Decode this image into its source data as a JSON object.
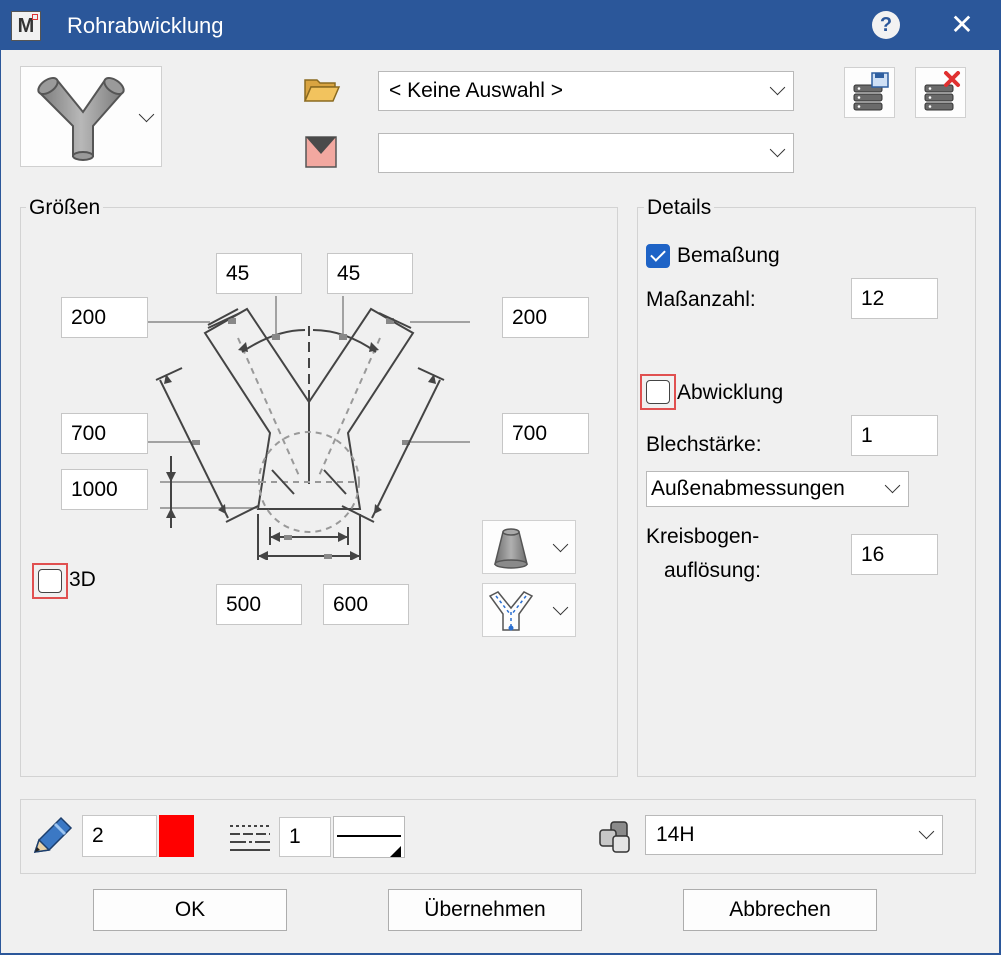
{
  "window": {
    "title": "Rohrabwicklung",
    "app_icon_letter": "M"
  },
  "presets": {
    "selection": "< Keine Auswahl >",
    "second_combo": ""
  },
  "groups": {
    "sizes": "Größen",
    "details": "Details"
  },
  "sizes": {
    "angle_left": "45",
    "angle_right": "45",
    "length_top_left": "200",
    "length_top_right": "200",
    "length_mid_left": "700",
    "length_mid_right": "700",
    "height_left": "1000",
    "diameter_bottom_left": "500",
    "diameter_bottom_right": "600",
    "checkbox_3d_label": "3D",
    "checkbox_3d_checked": false
  },
  "details": {
    "bemassung_label": "Bemaßung",
    "bemassung_checked": true,
    "masszahl_label": "Maßanzahl:",
    "masszahl_value": "12",
    "abwicklung_label": "Abwicklung",
    "abwicklung_checked": false,
    "blechstaerke_label": "Blechstärke:",
    "blechstaerke_value": "1",
    "dimension_mode": "Außenabmessungen",
    "kreisbogen_label_1": "Kreisbogen-",
    "kreisbogen_label_2": "auflösung:",
    "kreisbogen_value": "16"
  },
  "format_bar": {
    "pen_value": "2",
    "pen_color": "#ff0000",
    "line_value": "1",
    "layer_value": "14H"
  },
  "buttons": {
    "ok": "OK",
    "apply": "Übernehmen",
    "cancel": "Abbrechen"
  },
  "colors": {
    "title_bar": "#2b579a",
    "dialog_bg": "#f0f0f0",
    "checkbox_checked": "#1e63c6",
    "highlight": "#e05050"
  },
  "icons": {
    "app": "app-m-icon",
    "help": "help-icon",
    "close": "close-icon",
    "folder": "folder-open-icon",
    "style": "style-icon",
    "save_db": "save-database-icon",
    "delete_db": "delete-database-icon",
    "pipe": "y-pipe-icon",
    "cone": "cone-icon",
    "y_axis": "y-pipe-axis-icon",
    "pen": "pen-icon",
    "line_type": "line-type-icon",
    "layer": "layer-icon"
  }
}
